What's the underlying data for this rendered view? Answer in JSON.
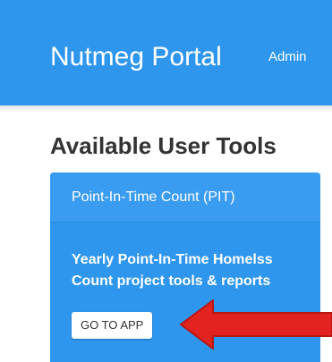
{
  "header": {
    "brand": "Nutmeg Portal",
    "admin_link": "Admin"
  },
  "main": {
    "section_title": "Available User Tools",
    "tools": [
      {
        "title": "Point-In-Time Count (PIT)",
        "description": "Yearly Point-In-Time Homelss Count project tools & reports",
        "button_label": "GO TO APP"
      }
    ]
  },
  "colors": {
    "primary": "#2f96ee",
    "annotation_arrow": "#e3231f"
  },
  "icons": {
    "annotation": "red-arrow-icon"
  }
}
